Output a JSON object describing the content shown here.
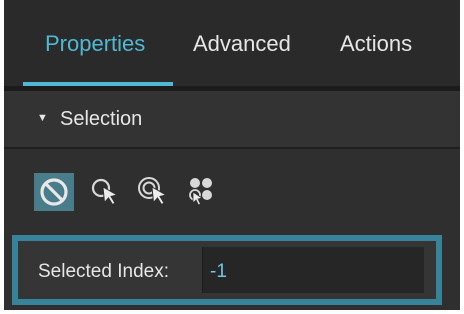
{
  "tabs": [
    {
      "label": "Properties",
      "active": true
    },
    {
      "label": "Advanced",
      "active": false
    },
    {
      "label": "Actions",
      "active": false
    }
  ],
  "section": {
    "title": "Selection",
    "arrow_glyph": "▼",
    "expanded": true
  },
  "selection_tools": [
    {
      "icon": "no-selection-icon",
      "selected": true
    },
    {
      "icon": "single-select-cursor-icon",
      "selected": false
    },
    {
      "icon": "multi-select-cursor-icon",
      "selected": false
    },
    {
      "icon": "group-select-icon",
      "selected": false
    }
  ],
  "selected_index": {
    "label": "Selected Index:",
    "value": "-1",
    "highlighted": true
  },
  "colors": {
    "accent": "#4fb8d3",
    "tab_background": "#2a2a2a",
    "section_header": "#333333",
    "panel_background": "#2f2f2f",
    "highlight_border": "#37839a",
    "field_value": "#6fc6e0",
    "text": "#e6e6e6"
  }
}
